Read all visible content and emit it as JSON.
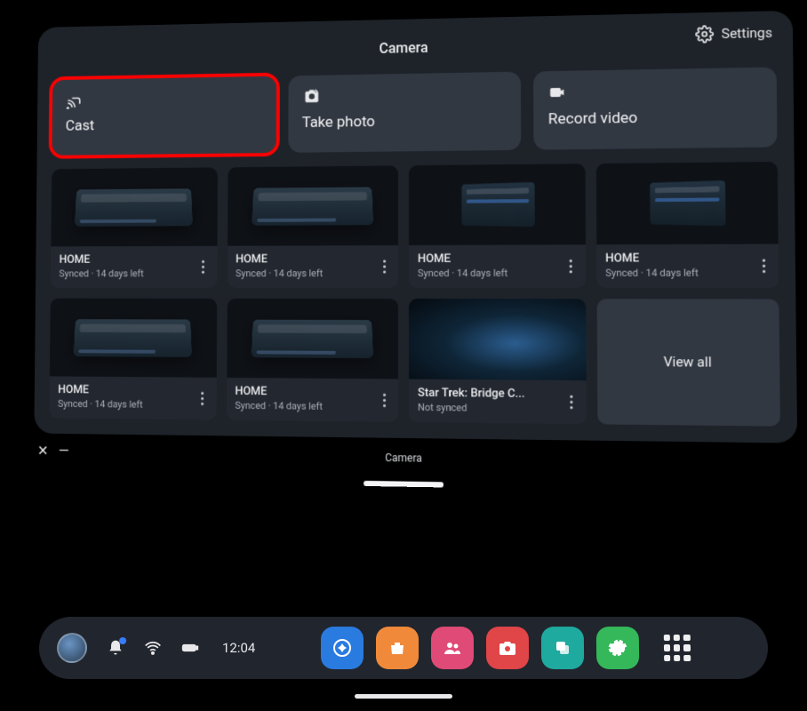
{
  "header": {
    "title": "Camera",
    "settings_label": "Settings"
  },
  "actions": {
    "cast_label": "Cast",
    "photo_label": "Take photo",
    "record_label": "Record video"
  },
  "grid": {
    "items": [
      {
        "title": "HOME",
        "sub": "Synced · 14 days left"
      },
      {
        "title": "HOME",
        "sub": "Synced · 14 days left"
      },
      {
        "title": "HOME",
        "sub": "Synced · 14 days left"
      },
      {
        "title": "HOME",
        "sub": "Synced · 14 days left"
      },
      {
        "title": "HOME",
        "sub": "Synced · 14 days left"
      },
      {
        "title": "HOME",
        "sub": "Synced · 14 days left"
      },
      {
        "title": "Star Trek: Bridge C...",
        "sub": "Not synced"
      }
    ],
    "view_all_label": "View all"
  },
  "window_bar": {
    "title": "Camera"
  },
  "taskbar": {
    "time": "12:04"
  }
}
